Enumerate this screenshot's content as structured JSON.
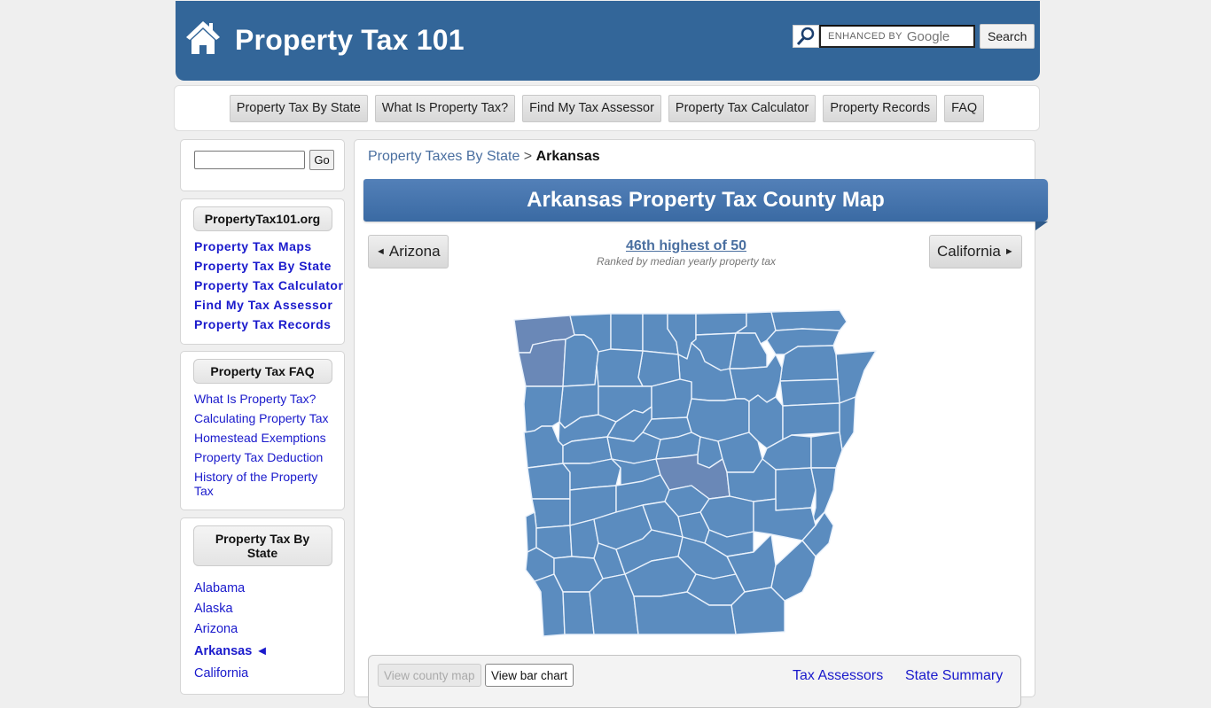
{
  "header": {
    "site_title": "Property Tax 101",
    "search": {
      "placeholder": "ENHANCED BY",
      "brand": "Google",
      "button_label": "Search"
    }
  },
  "nav": {
    "items": [
      {
        "label": "Property Tax By State"
      },
      {
        "label": "What Is Property Tax?"
      },
      {
        "label": "Find My Tax Assessor"
      },
      {
        "label": "Property Tax Calculator"
      },
      {
        "label": "Property Records"
      },
      {
        "label": "FAQ"
      }
    ]
  },
  "sidebar": {
    "search": {
      "value": "",
      "go_label": "Go"
    },
    "org": {
      "heading": "PropertyTax101.org",
      "links": [
        "Property Tax Maps",
        "Property Tax By State",
        "Property Tax Calculator",
        "Find My Tax Assessor",
        "Property Tax Records"
      ]
    },
    "faq": {
      "heading": "Property Tax FAQ",
      "links": [
        "What Is Property Tax?",
        "Calculating Property Tax",
        "Homestead Exemptions",
        "Property Tax Deduction",
        "History of the Property Tax"
      ]
    },
    "states": {
      "heading": "Property Tax By State",
      "links": [
        "Alabama",
        "Alaska",
        "Arizona"
      ],
      "active": "Arkansas ◄",
      "after": [
        "California"
      ]
    }
  },
  "main": {
    "breadcrumb": {
      "parent": "Property Taxes By State",
      "separator": ">",
      "current": "Arkansas"
    },
    "title": "Arkansas Property Tax County Map",
    "prev_state": "Arizona",
    "next_state": "California",
    "prev_arrow": "◄",
    "next_arrow": "►",
    "rank": {
      "label": "46th highest of 50",
      "sublabel": "Ranked by median yearly property tax"
    },
    "map": {
      "state": "Arkansas",
      "base_color": "#5b8cbf",
      "highlight_color": "#6a88b7",
      "border_color": "#e9f1fb"
    },
    "bottom": {
      "view_map_label": "View county map",
      "view_bar_label": "View bar chart",
      "links": [
        "Tax Assessors",
        "State Summary"
      ]
    }
  },
  "colors": {
    "header_bg": "#336699",
    "banner_bg": "#4473ab",
    "link": "#1a1acc",
    "link_muted": "#4a6fa0"
  }
}
